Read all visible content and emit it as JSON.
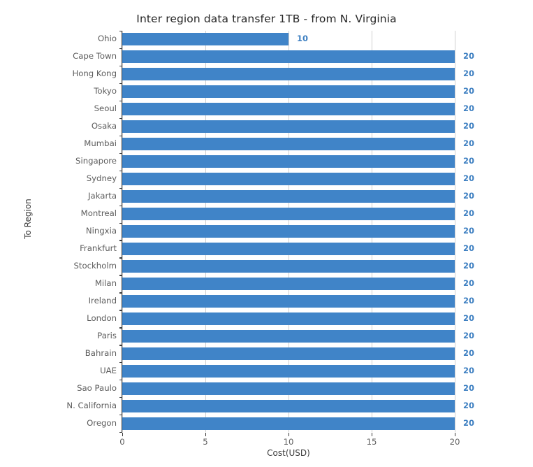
{
  "chart_data": {
    "type": "bar",
    "orientation": "horizontal",
    "title": "Inter region data transfer 1TB - from N. Virginia",
    "xlabel": "Cost(USD)",
    "ylabel": "To Region",
    "xlim": [
      0,
      20
    ],
    "xticks": [
      "0",
      "5",
      "10",
      "15",
      "20"
    ],
    "xtick_values": [
      0,
      5,
      10,
      15,
      20
    ],
    "grid": "vertical",
    "legend": null,
    "bar_color": "#4084c8",
    "label_color": "#3d7fc1",
    "categories": [
      "Ohio",
      "Cape Town",
      "Hong Kong",
      "Tokyo",
      "Seoul",
      "Osaka",
      "Mumbai",
      "Singapore",
      "Sydney",
      "Jakarta",
      "Montreal",
      "Ningxia",
      "Frankfurt",
      "Stockholm",
      "Milan",
      "Ireland",
      "London",
      "Paris",
      "Bahrain",
      "UAE",
      "Sao Paulo",
      "N. California",
      "Oregon"
    ],
    "values": [
      10,
      20,
      20,
      20,
      20,
      20,
      20,
      20,
      20,
      20,
      20,
      20,
      20,
      20,
      20,
      20,
      20,
      20,
      20,
      20,
      20,
      20,
      20
    ],
    "data_labels": [
      "10",
      "20",
      "20",
      "20",
      "20",
      "20",
      "20",
      "20",
      "20",
      "20",
      "20",
      "20",
      "20",
      "20",
      "20",
      "20",
      "20",
      "20",
      "20",
      "20",
      "20",
      "20",
      "20"
    ]
  }
}
